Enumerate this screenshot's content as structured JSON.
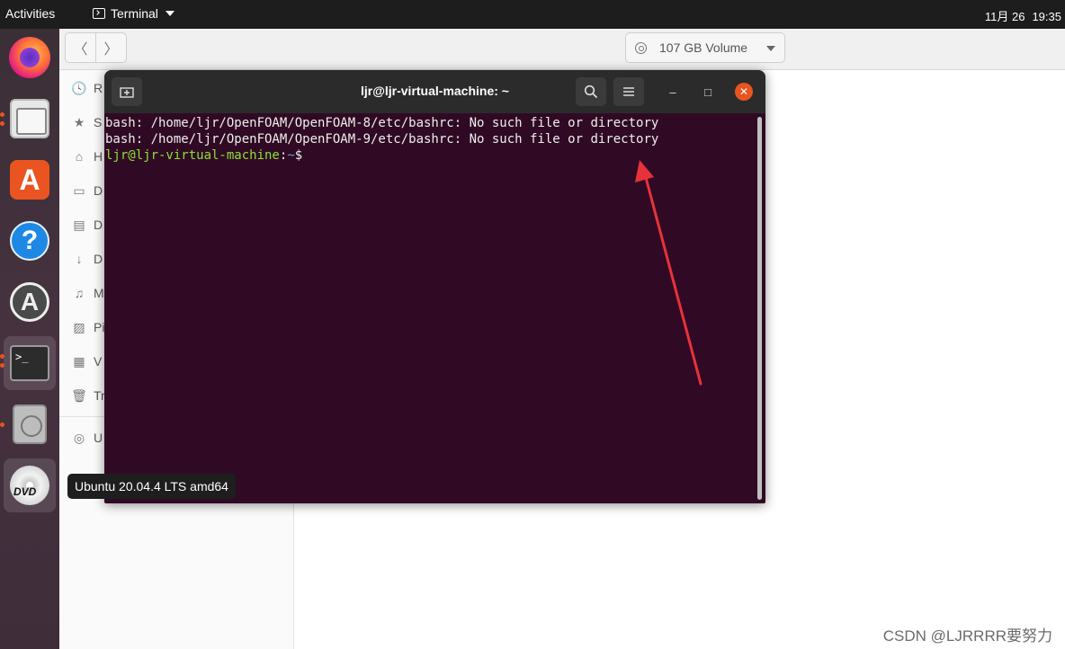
{
  "topbar": {
    "activities": "Activities",
    "app_name": "Terminal",
    "date": "11月 26",
    "time": "19:35"
  },
  "dock": {
    "tooltip": "Ubuntu 20.04.4 LTS amd64",
    "terminal_glyph": ">_"
  },
  "file_manager": {
    "back_glyph": "〈",
    "forward_glyph": "〉",
    "location": "107 GB Volume",
    "sidebar": [
      {
        "icon": "clock-icon",
        "glyph": "🕓",
        "label": "R"
      },
      {
        "icon": "star-icon",
        "glyph": "★",
        "label": "S"
      },
      {
        "icon": "home-icon",
        "glyph": "⌂",
        "label": "H"
      },
      {
        "icon": "desktop-icon",
        "glyph": "▭",
        "label": "D"
      },
      {
        "icon": "documents-icon",
        "glyph": "▤",
        "label": "D"
      },
      {
        "icon": "downloads-icon",
        "glyph": "↓",
        "label": "D"
      },
      {
        "icon": "music-icon",
        "glyph": "♫",
        "label": "M"
      },
      {
        "icon": "pictures-icon",
        "glyph": "▨",
        "label": "Pi"
      },
      {
        "icon": "videos-icon",
        "glyph": "▦",
        "label": "V"
      },
      {
        "icon": "trash-icon",
        "glyph": "🗑",
        "label": "Tr"
      },
      {
        "icon": "disc-icon",
        "glyph": "◎",
        "label": "U"
      }
    ]
  },
  "terminal": {
    "title": "ljr@ljr-virtual-machine: ~",
    "minimize_glyph": "–",
    "maximize_glyph": "□",
    "close_glyph": "✕",
    "lines": [
      "bash: /home/ljr/OpenFOAM/OpenFOAM-8/etc/bashrc: No such file or directory",
      "bash: /home/ljr/OpenFOAM/OpenFOAM-9/etc/bashrc: No such file or directory"
    ],
    "prompt_user": "ljr@ljr-virtual-machine",
    "prompt_sep": ":",
    "prompt_path": "~",
    "prompt_symbol": "$"
  },
  "colors": {
    "terminal_bg": "#300a24",
    "prompt_user": "#8ae234",
    "prompt_path": "#729fcf",
    "accent": "#e95420",
    "annotation_arrow": "#e8323a"
  },
  "watermark": "CSDN @LJRRRR要努力"
}
